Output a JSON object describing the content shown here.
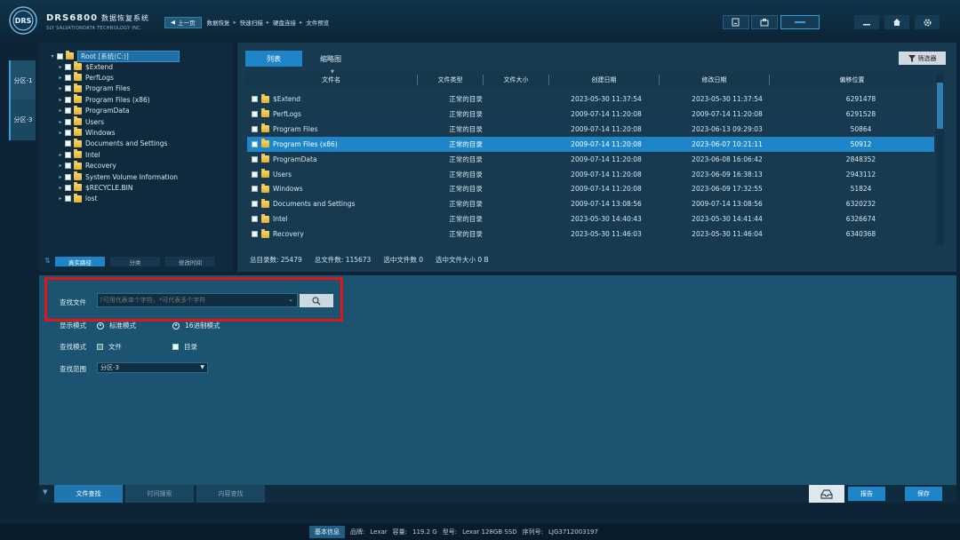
{
  "header": {
    "brand_name": "DRS6800",
    "brand_cn": "数据恢复系统",
    "brand_sub": "SLY SALVATIONDATA TECHNOLOGY INC.",
    "back_label": "上一页",
    "breadcrumbs": [
      "数据恢复",
      "快速扫描",
      "硬盘连接",
      "文件预览"
    ],
    "crumb_sep": "▸"
  },
  "side_tabs": [
    "分区-1",
    "分区-3"
  ],
  "tree": {
    "root": "Root [系统(C:)]",
    "items": [
      {
        "label": "$Extend",
        "expand": true
      },
      {
        "label": "PerfLogs",
        "expand": true
      },
      {
        "label": "Program Files",
        "expand": true
      },
      {
        "label": "Program Files (x86)",
        "expand": true
      },
      {
        "label": "ProgramData",
        "expand": true
      },
      {
        "label": "Users",
        "expand": true
      },
      {
        "label": "Windows",
        "expand": true
      },
      {
        "label": "Documents and Settings",
        "expand": false
      },
      {
        "label": "Intel",
        "expand": true
      },
      {
        "label": "Recovery",
        "expand": true
      },
      {
        "label": "System Volume Information",
        "expand": true
      },
      {
        "label": "$RECYCLE.BIN",
        "expand": true
      },
      {
        "label": "lost",
        "expand": true
      }
    ],
    "tabs": [
      "真实路径",
      "分类",
      "修改时间"
    ]
  },
  "view_tabs": [
    "列表",
    "缩略图"
  ],
  "filter_label": "筛选器",
  "table": {
    "columns": [
      "文件名",
      "文件类型",
      "文件大小",
      "创建日期",
      "修改日期",
      "偏移位置"
    ],
    "rows": [
      {
        "name": "$Extend",
        "type": "正常的目录",
        "size": "",
        "created": "2023-05-30 11:37:54",
        "modified": "2023-05-30 11:37:54",
        "offset": "6291478"
      },
      {
        "name": "PerfLogs",
        "type": "正常的目录",
        "size": "",
        "created": "2009-07-14 11:20:08",
        "modified": "2009-07-14 11:20:08",
        "offset": "6291528"
      },
      {
        "name": "Program Files",
        "type": "正常的目录",
        "size": "",
        "created": "2009-07-14 11:20:08",
        "modified": "2023-06-13 09:29:03",
        "offset": "50864"
      },
      {
        "name": "Program Files (x86)",
        "type": "正常的目录",
        "size": "",
        "created": "2009-07-14 11:20:08",
        "modified": "2023-06-07 10:21:11",
        "offset": "50912"
      },
      {
        "name": "ProgramData",
        "type": "正常的目录",
        "size": "",
        "created": "2009-07-14 11:20:08",
        "modified": "2023-06-08 16:06:42",
        "offset": "2848352"
      },
      {
        "name": "Users",
        "type": "正常的目录",
        "size": "",
        "created": "2009-07-14 11:20:08",
        "modified": "2023-06-09 16:38:13",
        "offset": "2943112"
      },
      {
        "name": "Windows",
        "type": "正常的目录",
        "size": "",
        "created": "2009-07-14 11:20:08",
        "modified": "2023-06-09 17:32:55",
        "offset": "51824"
      },
      {
        "name": "Documents and Settings",
        "type": "正常的目录",
        "size": "",
        "created": "2009-07-14 13:08:56",
        "modified": "2009-07-14 13:08:56",
        "offset": "6320232"
      },
      {
        "name": "Intel",
        "type": "正常的目录",
        "size": "",
        "created": "2023-05-30 14:40:43",
        "modified": "2023-05-30 14:41:44",
        "offset": "6326674"
      },
      {
        "name": "Recovery",
        "type": "正常的目录",
        "size": "",
        "created": "2023-05-30 11:46:03",
        "modified": "2023-05-30 11:46:04",
        "offset": "6340368"
      }
    ],
    "selected_index": 3
  },
  "stats": {
    "total_dirs": "总目录数: 25479",
    "total_files": "总文件数: 115673",
    "selected_files": "选中文件数 0",
    "selected_size": "选中文件大小 0 B"
  },
  "search": {
    "find_label": "查找文件",
    "placeholder": "?可用代表单个字符，*可代表多个字符",
    "display_label": "显示模式",
    "display_opts": [
      "标准模式",
      "16进制模式"
    ],
    "mode_label": "查找模式",
    "mode_opts": [
      "文件",
      "目录"
    ],
    "scope_label": "查找范围",
    "scope_value": "分区-3"
  },
  "bottom": {
    "tabs": [
      "文件查找",
      "时间搜索",
      "内容查找"
    ],
    "report": "报告",
    "save": "保存"
  },
  "status": {
    "basic": "基本信息",
    "brand_label": "品牌:",
    "brand": "Lexar",
    "cap_label": "容量:",
    "capacity": "119.2 G",
    "model_label": "型号:",
    "model": "Lexar 128GB SSD",
    "serial_label": "序列号:",
    "serial": "LJG3712003197"
  },
  "colors": {
    "accent": "#1f85c9",
    "highlight": "#e01515"
  }
}
